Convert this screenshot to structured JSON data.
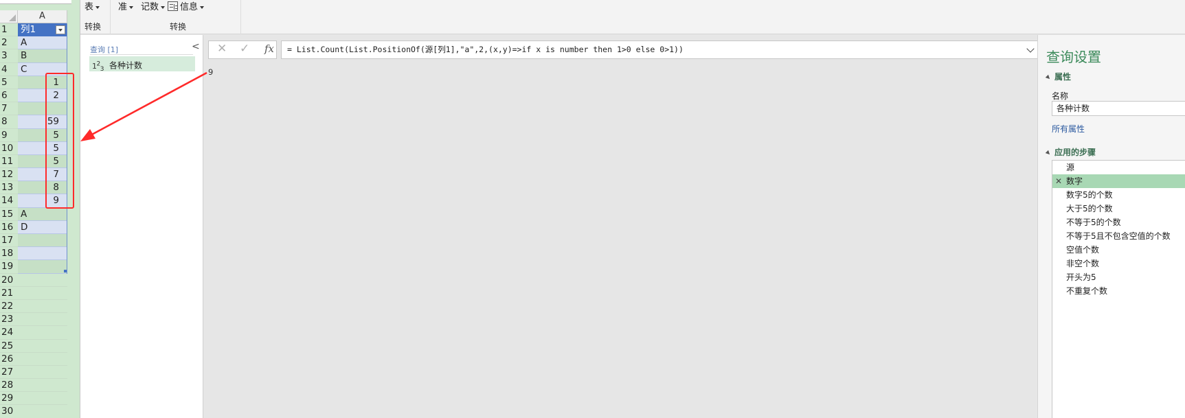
{
  "sheet": {
    "column_header": "A",
    "row_numbers": [
      "1",
      "2",
      "3",
      "4",
      "5",
      "6",
      "7",
      "8",
      "9",
      "10",
      "11",
      "12",
      "13",
      "14",
      "15",
      "16",
      "17",
      "18",
      "19",
      "20",
      "21",
      "22",
      "23",
      "24",
      "25",
      "26",
      "27",
      "28",
      "29",
      "30"
    ],
    "header_cell": "列1",
    "values": [
      "A",
      "B",
      "C",
      "1",
      "2",
      "",
      "59",
      "5",
      "5",
      "5",
      "7",
      "8",
      "9",
      "A",
      "D",
      "",
      "",
      ""
    ]
  },
  "ribbon": {
    "buttons": [
      "表",
      "准",
      "记数",
      "信息"
    ],
    "group_labels": [
      "转换",
      "转换"
    ]
  },
  "queries": {
    "title": "查询 [1]",
    "collapse_glyph": "<",
    "items": [
      {
        "label": "各种计数"
      }
    ]
  },
  "formula_bar": {
    "cancel_glyph": "✕",
    "confirm_glyph": "✓",
    "fx_label": "fx",
    "formula": "= List.Count(List.PositionOf(源[列1],\"a\",2,(x,y)=>if x is number then 1>0 else 0>1))"
  },
  "result": {
    "value": "9"
  },
  "settings": {
    "title": "查询设置",
    "properties_label": "属性",
    "name_label": "名称",
    "name_value": "各种计数",
    "all_properties_link": "所有属性",
    "applied_steps_label": "应用的步骤",
    "delete_glyph": "✕",
    "steps": [
      "源",
      "数字",
      "数字5的个数",
      "大于5的个数",
      "不等于5的个数",
      "不等于5且不包含空值的个数",
      "空值个数",
      "非空个数",
      "开头为5",
      "不重复个数"
    ],
    "selected_step_index": 1
  },
  "annotation_color": "#ff2a2a"
}
